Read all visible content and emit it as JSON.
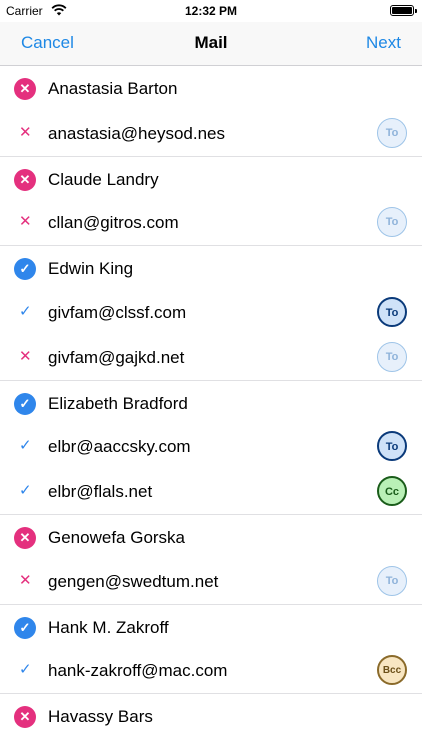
{
  "status": {
    "carrier": "Carrier",
    "time": "12:32 PM"
  },
  "nav": {
    "cancel": "Cancel",
    "title": "Mail",
    "next": "Next"
  },
  "contacts": [
    {
      "name": "Anastasia Barton",
      "status": "unselected",
      "emails": [
        {
          "address": "anastasia@heysod.nes",
          "status": "unselected",
          "badge": "To",
          "badge_active": false
        }
      ]
    },
    {
      "name": "Claude Landry",
      "status": "unselected",
      "emails": [
        {
          "address": "cllan@gitros.com",
          "status": "unselected",
          "badge": "To",
          "badge_active": false
        }
      ]
    },
    {
      "name": "Edwin King",
      "status": "selected",
      "emails": [
        {
          "address": "givfam@clssf.com",
          "status": "selected",
          "badge": "To",
          "badge_active": true
        },
        {
          "address": "givfam@gajkd.net",
          "status": "unselected",
          "badge": "To",
          "badge_active": false
        }
      ]
    },
    {
      "name": "Elizabeth Bradford",
      "status": "selected",
      "emails": [
        {
          "address": "elbr@aaccsky.com",
          "status": "selected",
          "badge": "To",
          "badge_active": true
        },
        {
          "address": "elbr@flals.net",
          "status": "selected",
          "badge": "Cc",
          "badge_active": true
        }
      ]
    },
    {
      "name": "Genowefa Gorska",
      "status": "unselected",
      "emails": [
        {
          "address": "gengen@swedtum.net",
          "status": "unselected",
          "badge": "To",
          "badge_active": false
        }
      ]
    },
    {
      "name": "Hank M. Zakroff",
      "status": "selected",
      "emails": [
        {
          "address": "hank-zakroff@mac.com",
          "status": "selected",
          "badge": "Bcc",
          "badge_active": true
        }
      ]
    },
    {
      "name": "Havassy Bars",
      "status": "unselected",
      "emails": []
    }
  ],
  "colors": {
    "accent": "#1e88e5",
    "unselected": "#e4307e",
    "selected": "#2f86eb"
  },
  "icons": {
    "selected": "checkmark-icon",
    "unselected": "cross-icon"
  }
}
